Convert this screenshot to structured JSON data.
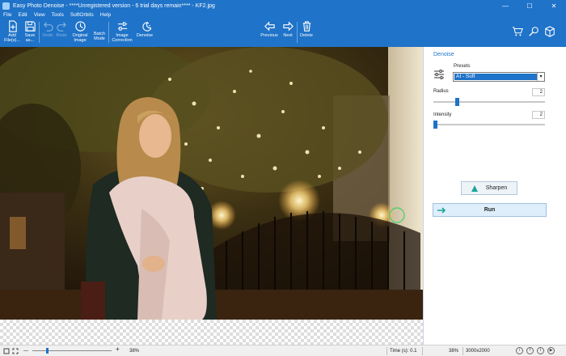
{
  "window": {
    "title": "Easy Photo Denoise - ****Unregistered version - 6 trial days remain**** - KF2.jpg",
    "controls": [
      "—",
      "☐",
      "✕"
    ]
  },
  "menu": [
    "File",
    "Edit",
    "View",
    "Tools",
    "SoftOrbits",
    "Help"
  ],
  "toolbar": {
    "add_files": "Add File(s)...",
    "save_as": "Save as...",
    "undo": "Undo",
    "redo": "Redo",
    "original_image": "Original Image",
    "batch_mode": "Batch Mode",
    "image_correction": "Image Correction",
    "denoise": "Denoise",
    "previous": "Previous",
    "next": "Next",
    "delete": "Delete"
  },
  "panel": {
    "title": "Denoise",
    "presets_label": "Presets",
    "preset_value": "AI - Soft",
    "radius_label": "Radius",
    "radius_value": "2",
    "radius_level": 0.2,
    "intensity_label": "Intensity",
    "intensity_value": "2",
    "intensity_level": 0.0,
    "sharpen_label": "Sharpen",
    "run_label": "Run"
  },
  "status": {
    "zoom_left": "38%",
    "time": "Time (s): 0.1",
    "zoom_right": "38%",
    "dimensions": "3000x2000",
    "social": [
      "i",
      "f",
      "t",
      "▶"
    ]
  },
  "colors": {
    "accent": "#1f73c8",
    "sharpen_icon": "#1aa69a",
    "run_arrow": "#1aa69a"
  }
}
